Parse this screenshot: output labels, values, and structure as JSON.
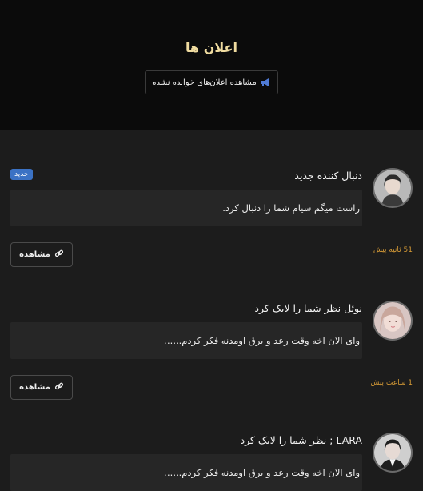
{
  "header": {
    "title": "اعلان ها",
    "unread_button_label": "مشاهده اعلان‌های خوانده نشده",
    "unread_button_icon": "megaphone-icon"
  },
  "notifications": [
    {
      "title": "دنبال کننده جدید",
      "badge": "جدید",
      "message": "راست میگم سیام شما را دنبال کرد.",
      "time": "51 ثانیه پیش",
      "view_label": "مشاهده",
      "view_icon": "link-icon"
    },
    {
      "title": "نوئل نظر شما را لایک کرد",
      "message": "وای الان اخه وقت رعد و برق اومدنه فکر کردم......",
      "time": "1 ساعت پیش",
      "view_label": "مشاهده",
      "view_icon": "link-icon"
    },
    {
      "title": "LARA ; نظر شما را لایک کرد",
      "message": "وای الان اخه وقت رعد و برق اومدنه فکر کردم......"
    }
  ],
  "colors": {
    "header_bg": "#0b0b0b",
    "page_bg": "#1c1c1c",
    "title_gold": "#f0dca0",
    "badge_blue": "#3b72c4",
    "time_orange": "#d59a36"
  }
}
